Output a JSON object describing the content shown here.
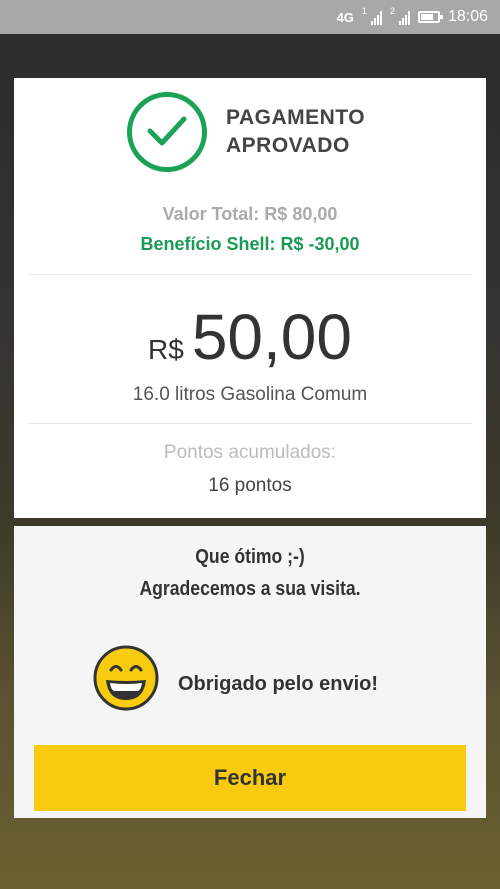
{
  "status_bar": {
    "network": "4G",
    "sim1": "1",
    "sim2": "2",
    "time": "18:06",
    "battery_level": 0.75
  },
  "receipt": {
    "status_line1": "PAGAMENTO",
    "status_line2": "APROVADO",
    "valor_total": "Valor Total: R$ 80,00",
    "beneficio": "Benefício Shell: R$ -30,00",
    "currency": "R$",
    "amount": "50,00",
    "fuel_description": "16.0 litros Gasolina Comum",
    "points_label": "Pontos acumulados:",
    "points_value": "16 pontos"
  },
  "feedback": {
    "line1": "Que ótimo ;-)",
    "line2": "Agradecemos a sua visita.",
    "sent_text": "Obrigado pelo envio!",
    "close_label": "Fechar"
  },
  "colors": {
    "approved_green": "#1aa257",
    "benefit_green": "#1a9a55",
    "button_yellow": "#f8cb0f",
    "emoji_yellow": "#f8cb0f"
  },
  "icons": {
    "approved": "check-circle-icon",
    "emoji": "grinning-face-icon"
  }
}
